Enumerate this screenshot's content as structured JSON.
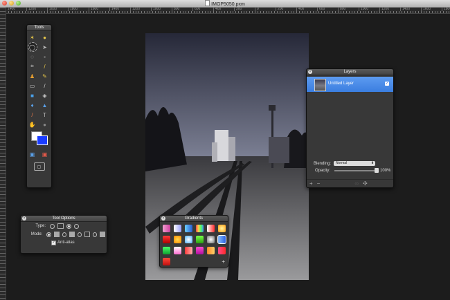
{
  "window": {
    "title": "IMGP5050.pxm"
  },
  "ruler": {
    "labels": [
      "1400",
      "1200",
      "1000",
      "1800",
      "1600",
      "1400",
      "1200",
      "1000",
      "800",
      "600",
      "400",
      "200",
      "0",
      "200",
      "400",
      "600",
      "800",
      "1000",
      "1200",
      "1400",
      "1600",
      "1800",
      "2000",
      "2200"
    ]
  },
  "tools_panel": {
    "title": "Tools",
    "tools": [
      {
        "icon": "wand-icon",
        "glyph": "✶",
        "color": "#e8c84a"
      },
      {
        "icon": "eggs-icon",
        "glyph": "●",
        "color": "#e8c84a"
      },
      {
        "icon": "ellipse-select-icon",
        "glyph": "◯",
        "color": "#ddd"
      },
      {
        "icon": "arrow-icon",
        "glyph": "➤",
        "color": "#bbb"
      },
      {
        "icon": "lasso-icon",
        "glyph": "◌",
        "color": "#bbb"
      },
      {
        "icon": "magic-select-icon",
        "glyph": "▪",
        "color": "#888"
      },
      {
        "icon": "crop-icon",
        "glyph": "⌗",
        "color": "#bbb"
      },
      {
        "icon": "eyedropper-icon",
        "glyph": "/",
        "color": "#e8c84a"
      },
      {
        "icon": "stamp-icon",
        "glyph": "♟",
        "color": "#e8a030"
      },
      {
        "icon": "pencil-icon",
        "glyph": "✎",
        "color": "#e8c84a"
      },
      {
        "icon": "eraser-icon",
        "glyph": "▭",
        "color": "#ddd"
      },
      {
        "icon": "brush-icon",
        "glyph": "/",
        "color": "#ccc"
      },
      {
        "icon": "gradient-icon",
        "glyph": "■",
        "color": "#4aa0e8"
      },
      {
        "icon": "fill-icon",
        "glyph": "◈",
        "color": "#ccc"
      },
      {
        "icon": "drop-icon",
        "glyph": "♦",
        "color": "#5aa0e8"
      },
      {
        "icon": "sharpen-icon",
        "glyph": "▲",
        "color": "#5aa0e8"
      },
      {
        "icon": "smudge-icon",
        "glyph": "/",
        "color": "#e87a4a"
      },
      {
        "icon": "text-icon",
        "glyph": "T",
        "color": "#bbb"
      },
      {
        "icon": "hand-icon",
        "glyph": "✋",
        "color": "#ddd"
      },
      {
        "icon": "zoom-icon",
        "glyph": "●",
        "color": "#888"
      }
    ],
    "extra": [
      {
        "icon": "quick-mask-icon",
        "glyph": "▣",
        "color": "#5aa0e8"
      },
      {
        "icon": "mask-mode-icon",
        "glyph": "▣",
        "color": "#e85a4a"
      }
    ],
    "fit_glyph": "▢"
  },
  "tool_options": {
    "title": "Tool Options",
    "type_label": "Type:",
    "mode_label": "Mode:",
    "anti_alias_label": "Anti-alias",
    "anti_alias_checked": true
  },
  "layers": {
    "title": "Layers",
    "layer_name": "Untitled Layer",
    "blending_label": "Blending:",
    "blending_value": "Normal",
    "opacity_label": "Opacity:",
    "opacity_value": "100%",
    "opacity_fraction": 1.0,
    "add_glyph": "+",
    "remove_glyph": "−",
    "link_glyph": "∞",
    "settings_glyph": "✣"
  },
  "gradients": {
    "title": "Gradients",
    "add_glyph": "+",
    "swatches": [
      "linear-gradient(90deg,#f0a0d0,#d040a0)",
      "linear-gradient(90deg,#ffffff,#9aa0ff)",
      "linear-gradient(90deg,#6ad0ff,#2a5cd0)",
      "linear-gradient(90deg,#ff4a4a,#ffd04a,#4aff6a,#4a8aff)",
      "linear-gradient(90deg,#ffffff,#ff2a2a)",
      "radial-gradient(#fff6a0,#ff9a10)",
      "linear-gradient(#ff3a3a,#b00000)",
      "radial-gradient(#ffd84a,#ff8a00)",
      "radial-gradient(#ffffff,#4ab0ff)",
      "linear-gradient(#7aff4a,#2aa010)",
      "radial-gradient(#ffffff,#707070)",
      "linear-gradient(90deg,#8ac0ff,#2a60e0)",
      "linear-gradient(#4aff6a,#10a030)",
      "linear-gradient(#ffffff,#ff6ad0)",
      "linear-gradient(90deg,#ff3a3a,#ffb0b0)",
      "linear-gradient(#ff4ad0,#b010a0)",
      "linear-gradient(90deg,#ff8a2a,#ffd06a)",
      "linear-gradient(90deg,#ff4a8a,#ff2a2a)",
      "linear-gradient(#ff4a3a,#c01010)"
    ]
  }
}
